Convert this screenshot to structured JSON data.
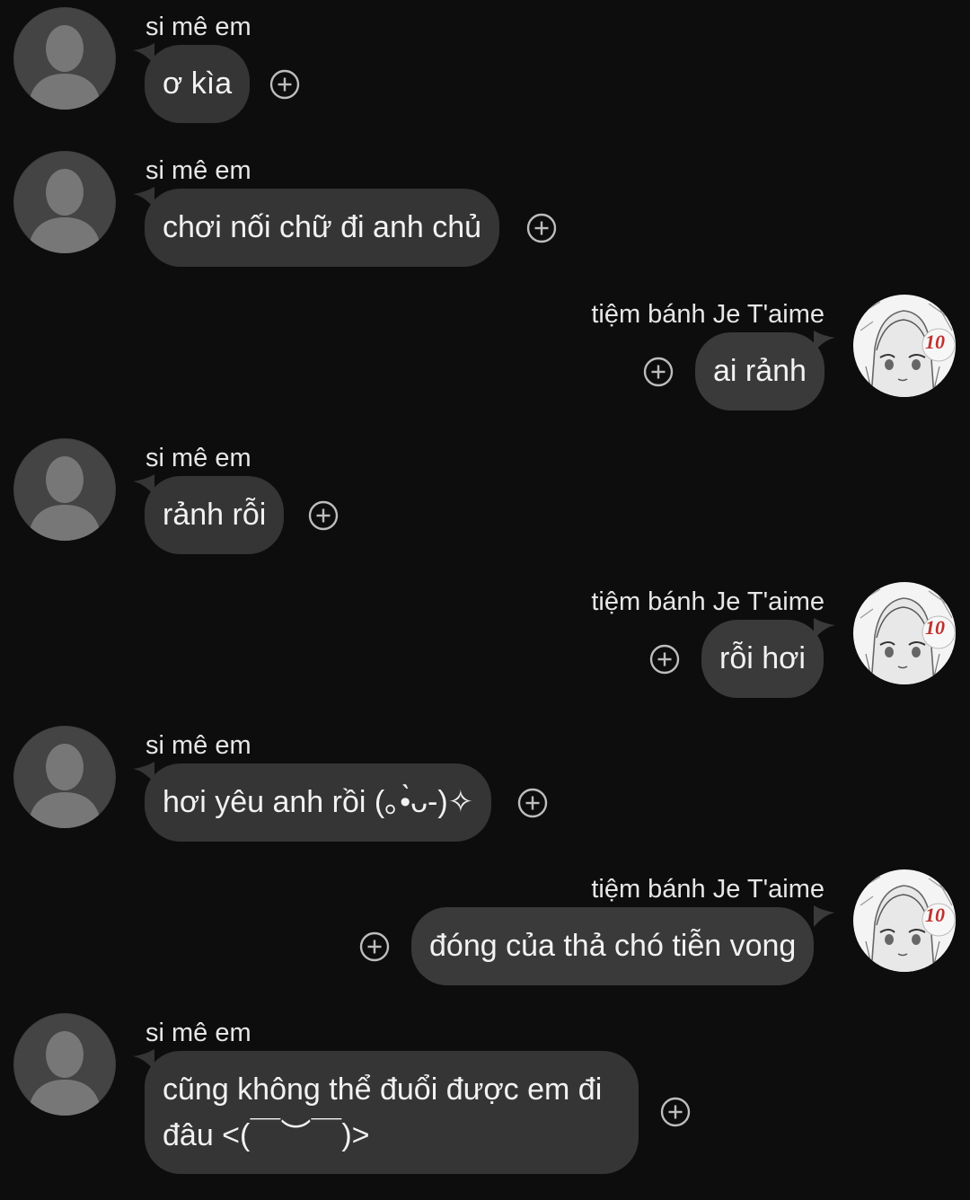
{
  "conversation": {
    "incoming_name": "si mê em",
    "outgoing_name": "tiệm bánh Je T'aime",
    "avatar_badge": "10",
    "messages": [
      {
        "from": "incoming",
        "text": "ơ kìa"
      },
      {
        "from": "incoming",
        "text": "chơi nối chữ đi anh chủ"
      },
      {
        "from": "outgoing",
        "text": "ai rảnh"
      },
      {
        "from": "incoming",
        "text": "rảnh rỗi"
      },
      {
        "from": "outgoing",
        "text": "rỗi hơi"
      },
      {
        "from": "incoming",
        "text": "hơi yêu anh rồi (｡•̀ᴗ-)✧"
      },
      {
        "from": "outgoing",
        "text": "đóng của thả chó tiễn vong"
      },
      {
        "from": "incoming",
        "text": "cũng không thể đuổi được em đi\nđâu <(￣︶￣)>"
      }
    ]
  },
  "colors": {
    "background": "#0d0d0d",
    "bubble": "#353535",
    "avatar_placeholder": "#4a4a4a"
  },
  "icons": {
    "add_reaction": "plus-circle-icon",
    "incoming_avatar": "person-silhouette-icon",
    "outgoing_avatar": "anime-sketch-avatar"
  }
}
